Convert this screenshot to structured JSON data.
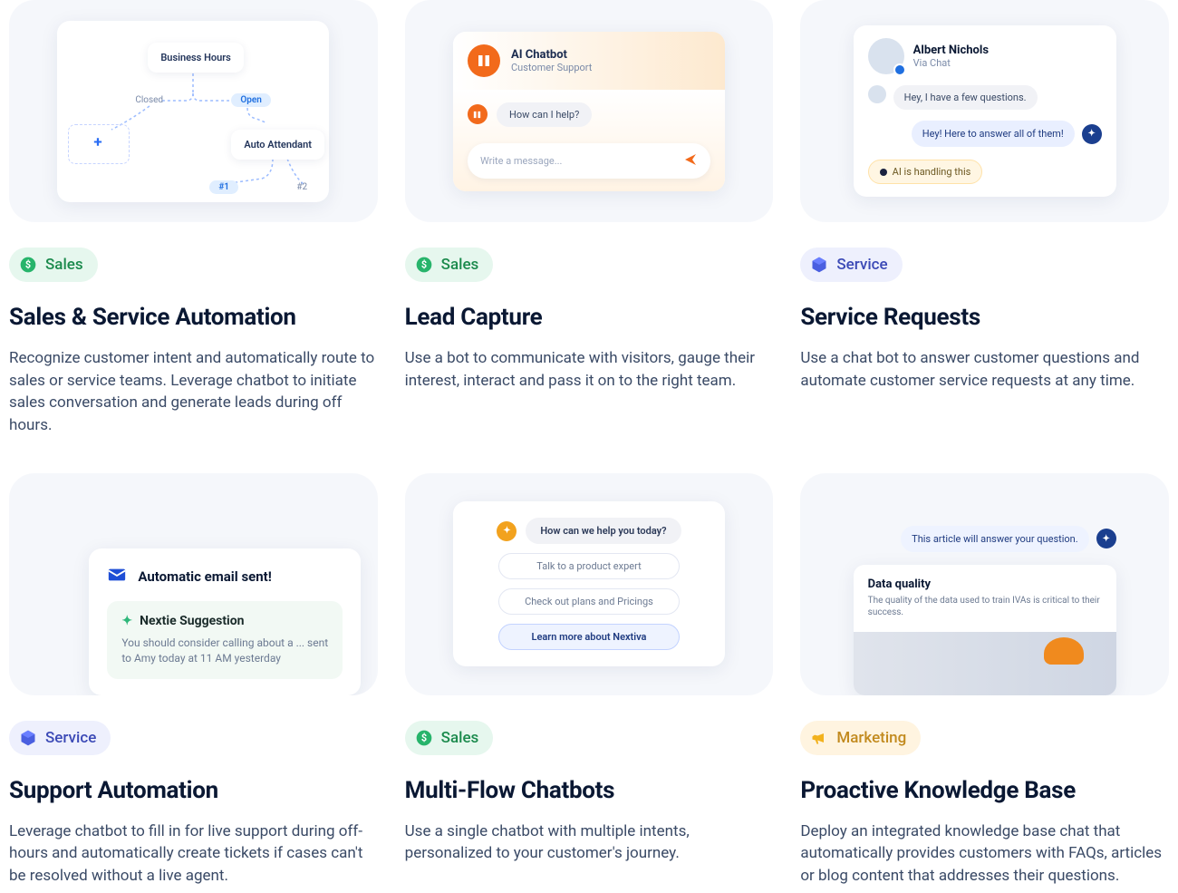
{
  "cards": [
    {
      "tag_type": "sales",
      "tag_label": "Sales",
      "title": "Sales & Service Automation",
      "desc": "Recognize customer intent and automatically route to sales or service teams. Leverage chatbot to initiate sales conversation and generate leads during off hours.",
      "illus": {
        "node1": "Business Hours",
        "node2": "Auto Attendant",
        "closed": "Closed",
        "open": "Open",
        "pill1": "#1",
        "pill2": "#2"
      }
    },
    {
      "tag_type": "sales",
      "tag_label": "Sales",
      "title": "Lead Capture",
      "desc": "Use a bot to communicate with visitors, gauge their interest, interact and pass it on to the right team.",
      "illus": {
        "bot_name": "AI Chatbot",
        "bot_sub": "Customer Support",
        "msg": "How can I help?",
        "placeholder": "Write a message..."
      }
    },
    {
      "tag_type": "service",
      "tag_label": "Service",
      "title": "Service Requests",
      "desc": "Use a chat bot to answer customer questions and automate customer service requests at any time.",
      "illus": {
        "name": "Albert Nichols",
        "sub": "Via Chat",
        "msg_in": "Hey, I have a few questions.",
        "msg_out": "Hey! Here to answer all of them!",
        "ai_badge": "AI is handling this"
      }
    },
    {
      "tag_type": "service",
      "tag_label": "Service",
      "title": "Support Automation",
      "desc": "Leverage chatbot to fill in for live support during off-hours and automatically create tickets if cases can't be resolved without a live agent.",
      "illus": {
        "email": "Automatic email sent!",
        "sugg_title": "Nextie Suggestion",
        "sugg_body": "You should consider calling about a ... sent to Amy today at 11 AM yesterday"
      }
    },
    {
      "tag_type": "sales",
      "tag_label": "Sales",
      "title": "Multi-Flow Chatbots",
      "desc": "Use a single chatbot with multiple intents, personalized to your customer's journey.",
      "illus": {
        "q": "How can we help you today?",
        "opt1": "Talk to a product expert",
        "opt2": "Check out plans and Pricings",
        "opt3": "Learn more about Nextiva"
      }
    },
    {
      "tag_type": "marketing",
      "tag_label": "Marketing",
      "title": "Proactive Knowledge Base",
      "desc": "Deploy an integrated knowledge base chat that automatically provides customers with FAQs, articles or blog content that addresses their questions.",
      "illus": {
        "msg": "This article will answer your question.",
        "article_title": "Data quality",
        "article_sub": "The quality of the data used to train IVAs is critical to their success."
      }
    }
  ]
}
